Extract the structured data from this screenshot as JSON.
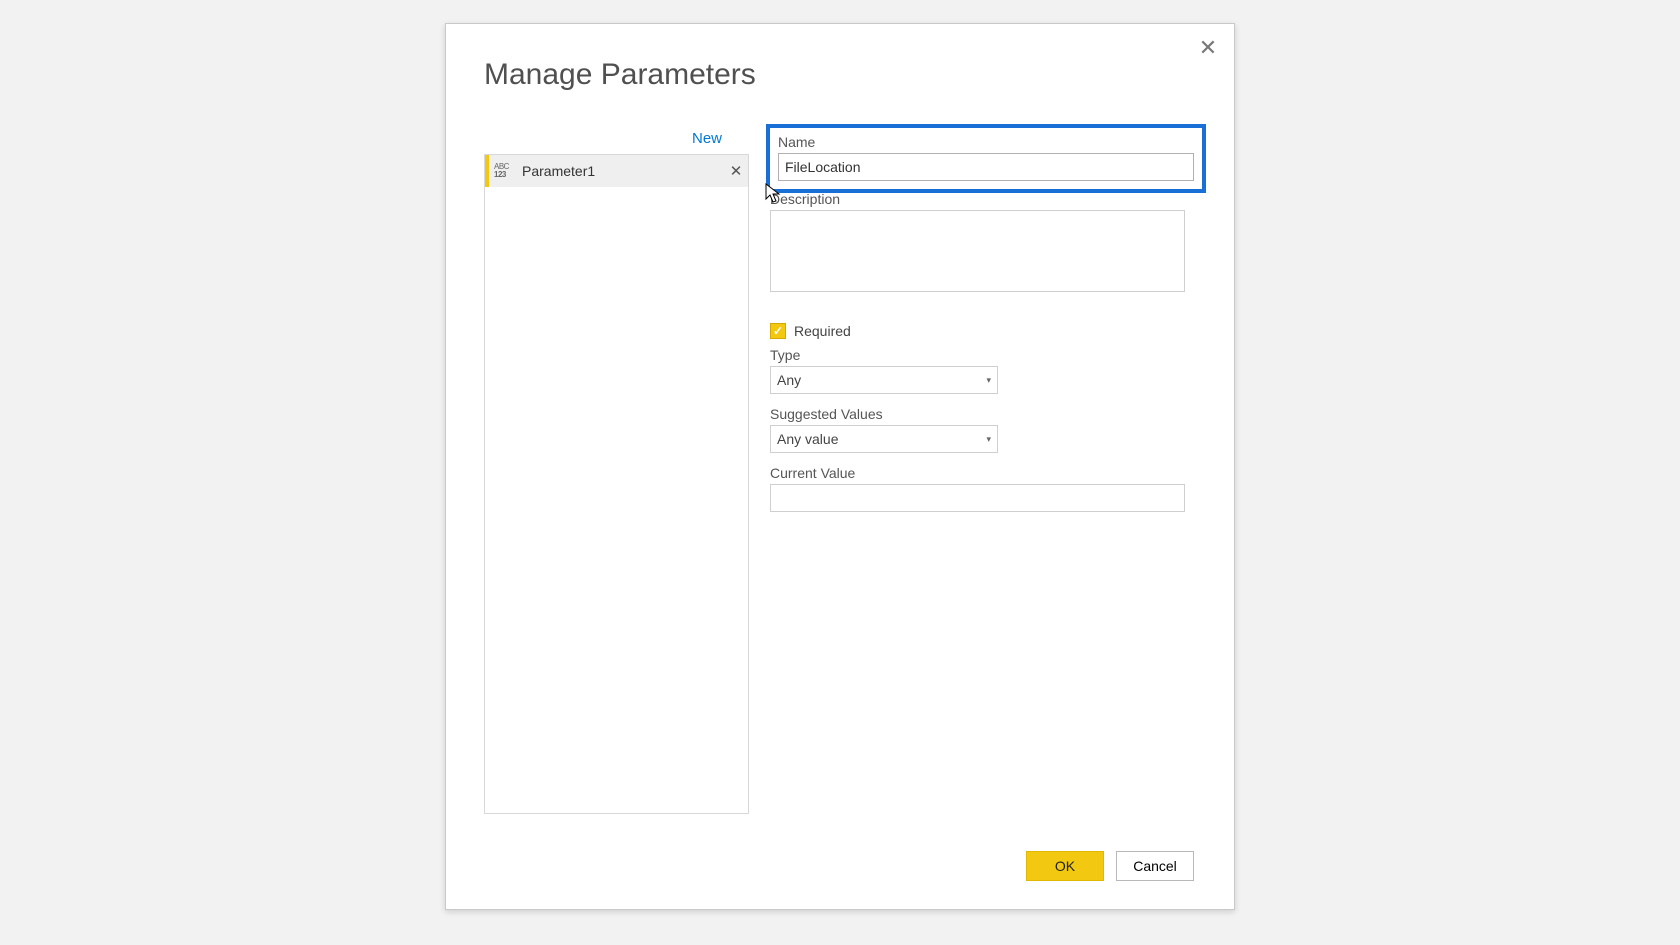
{
  "dialog": {
    "title": "Manage Parameters",
    "newLink": "New",
    "closeGlyph": "✕"
  },
  "paramList": {
    "items": [
      {
        "typeIconTop": "ABC",
        "typeIconBottom": "123",
        "label": "Parameter1",
        "deleteGlyph": "✕"
      }
    ]
  },
  "form": {
    "name": {
      "label": "Name",
      "value": "FileLocation"
    },
    "description": {
      "label": "Description",
      "value": ""
    },
    "required": {
      "label": "Required",
      "checked": true,
      "checkGlyph": "✓"
    },
    "type": {
      "label": "Type",
      "value": "Any"
    },
    "suggested": {
      "label": "Suggested Values",
      "value": "Any value"
    },
    "currentValue": {
      "label": "Current Value",
      "value": ""
    }
  },
  "buttons": {
    "ok": "OK",
    "cancel": "Cancel"
  },
  "caretGlyph": "▾"
}
